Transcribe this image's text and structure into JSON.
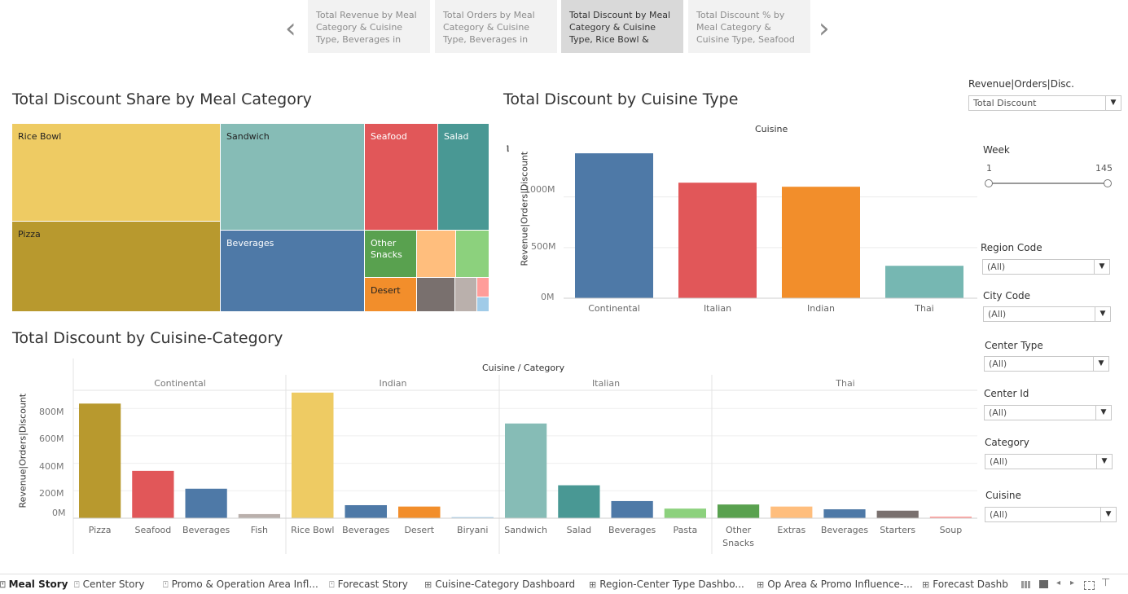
{
  "story_nav": {
    "points": [
      {
        "label": "Total Revenue by Meal Category & Cuisine Type, Beverages in"
      },
      {
        "label": "Total Orders by Meal Category & Cuisine Type, Beverages in"
      },
      {
        "label": "Total Discount by Meal Category & Cuisine Type, Rice Bowl &"
      },
      {
        "label": "Total Discount % by Meal Category & Cuisine Type, Seafood"
      }
    ],
    "prev_glyph": "‹",
    "next_glyph": "›"
  },
  "treemap": {
    "title": "Total Discount Share by Meal Category",
    "cells": [
      {
        "label": "Rice Bowl",
        "color": "#eecb63"
      },
      {
        "label": "Pizza",
        "color": "#b8992e"
      },
      {
        "label": "Sandwich",
        "color": "#86bcb6"
      },
      {
        "label": "Beverages",
        "color": "#4e79a7"
      },
      {
        "label": "Seafood",
        "color": "#e15759"
      },
      {
        "label": "Salad",
        "color": "#499894"
      },
      {
        "label": "Other Snacks",
        "color": "#59a14f"
      },
      {
        "label": "Desert",
        "color": "#f28e2b"
      }
    ]
  },
  "cuisine_chart": {
    "title": "Total Discount by Cuisine Type",
    "header": "Cuisine",
    "ylabel": "Revenue|Orders|Discount",
    "yticks": [
      "1000M",
      "500M",
      "0M"
    ]
  },
  "category_chart": {
    "title": "Total Discount by Cuisine-Category",
    "header": "Cuisine / Category",
    "ylabel": "Revenue|Orders|Discount",
    "yticks": [
      "800M",
      "600M",
      "400M",
      "200M",
      "0M"
    ],
    "groups": [
      "Continental",
      "Indian",
      "Italian",
      "Thai"
    ]
  },
  "chart_data": [
    {
      "type": "bar",
      "title": "Total Discount by Cuisine Type",
      "header": "Cuisine",
      "ylabel": "Revenue|Orders|Discount",
      "categories": [
        "Continental",
        "Italian",
        "Indian",
        "Thai"
      ],
      "values": [
        1430,
        1140,
        1100,
        320
      ],
      "colors": [
        "#4e79a7",
        "#e15759",
        "#f28e2b",
        "#76b7b2"
      ],
      "unit": "M",
      "ylim": [
        0,
        1600
      ],
      "grid": true
    },
    {
      "type": "bar",
      "title": "Total Discount by Cuisine-Category",
      "header": "Cuisine / Category",
      "ylabel": "Revenue|Orders|Discount",
      "unit": "M",
      "ylim": [
        0,
        920
      ],
      "grid": true,
      "groups": [
        {
          "name": "Continental",
          "categories": [
            "Pizza",
            "Seafood",
            "Beverages",
            "Fish"
          ],
          "values": [
            835,
            345,
            215,
            30
          ],
          "colors": [
            "#b8992e",
            "#e15759",
            "#4e79a7",
            "#bab0ac"
          ]
        },
        {
          "name": "Indian",
          "categories": [
            "Rice Bowl",
            "Beverages",
            "Desert",
            "Biryani"
          ],
          "values": [
            915,
            95,
            85,
            8
          ],
          "colors": [
            "#eecb63",
            "#4e79a7",
            "#f28e2b",
            "#a0cbe8"
          ]
        },
        {
          "name": "Italian",
          "categories": [
            "Sandwich",
            "Salad",
            "Beverages",
            "Pasta"
          ],
          "values": [
            690,
            240,
            125,
            70
          ],
          "colors": [
            "#86bcb6",
            "#499894",
            "#4e79a7",
            "#8cd17d"
          ]
        },
        {
          "name": "Thai",
          "categories": [
            "Other Snacks",
            "Extras",
            "Beverages",
            "Starters",
            "Soup"
          ],
          "values": [
            100,
            85,
            65,
            55,
            12
          ],
          "colors": [
            "#59a14f",
            "#ffbe7d",
            "#4e79a7",
            "#79706e",
            "#ff9d9a"
          ]
        }
      ]
    },
    {
      "type": "heatmap",
      "title": "Total Discount Share by Meal Category",
      "categories": [
        "Rice Bowl",
        "Pizza",
        "Sandwich",
        "Beverages",
        "Seafood",
        "Salad",
        "Other Snacks",
        "Desert"
      ]
    }
  ],
  "filters": {
    "measure_label": "Revenue|Orders|Disc.",
    "measure_value": "Total Discount",
    "week_label": "Week",
    "week_min": "1",
    "week_max": "145",
    "region_label": "Region Code",
    "region_value": "(All)",
    "city_label": "City Code",
    "city_value": "(All)",
    "center_type_label": "Center Type",
    "center_type_value": "(All)",
    "center_id_label": "Center Id",
    "center_id_value": "(All)",
    "category_label": "Category",
    "category_value": "(All)",
    "cuisine_label": "Cuisine",
    "cuisine_value": "(All)"
  },
  "tabs": [
    {
      "label": "Meal Story",
      "icon": "story-icon",
      "glyph": "⍞"
    },
    {
      "label": "Center Story",
      "icon": "story-icon",
      "glyph": "⍞"
    },
    {
      "label": "Promo & Operation Area Infl...",
      "icon": "story-icon",
      "glyph": "⍞"
    },
    {
      "label": "Forecast Story",
      "icon": "story-icon",
      "glyph": "⍞"
    },
    {
      "label": "Cuisine-Category Dashboard",
      "icon": "dashboard-icon",
      "glyph": "⊞"
    },
    {
      "label": "Region-Center Type Dashbo...",
      "icon": "dashboard-icon",
      "glyph": "⊞"
    },
    {
      "label": "Op Area & Promo Influence-...",
      "icon": "dashboard-icon",
      "glyph": "⊞"
    },
    {
      "label": "Forecast Dashb",
      "icon": "dashboard-icon",
      "glyph": "⊞"
    }
  ]
}
